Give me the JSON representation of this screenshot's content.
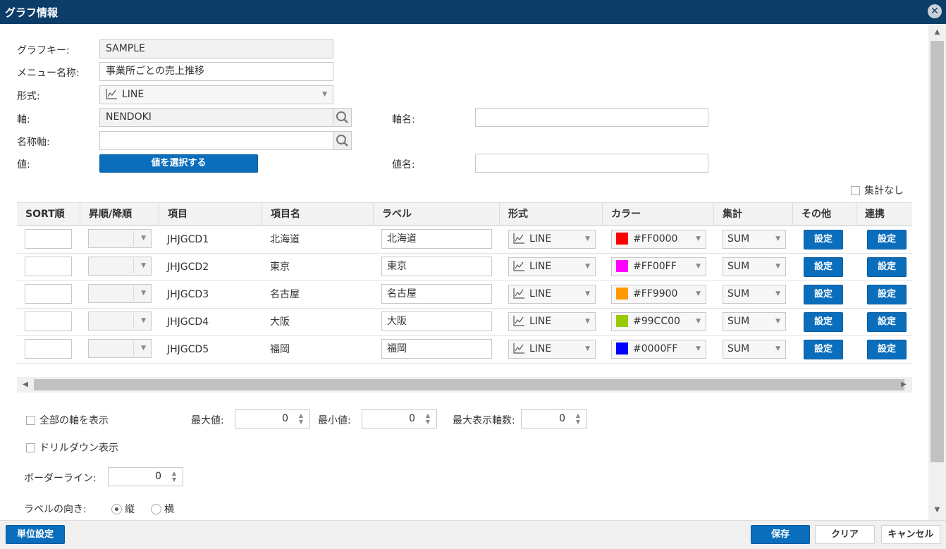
{
  "window": {
    "title": "グラフ情報",
    "close_glyph": "✕"
  },
  "form": {
    "graph_key_label": "グラフキー:",
    "graph_key_value": "SAMPLE",
    "menu_name_label": "メニュー名称:",
    "menu_name_value": "事業所ごとの売上推移",
    "format_label": "形式:",
    "format_value": "LINE",
    "axis_label": "軸:",
    "axis_value": "NENDOKI",
    "axis_name_label": "軸名:",
    "axis_name_value": "",
    "name_axis_label": "名称軸:",
    "name_axis_value": "",
    "value_label": "値:",
    "select_values_button": "値を選択する",
    "value_name_label": "値名:",
    "value_name_value": "",
    "no_aggregation_label": "集計なし"
  },
  "grid": {
    "headers": [
      "SORT順",
      "昇順/降順",
      "項目",
      "項目名",
      "ラベル",
      "形式",
      "カラー",
      "集計",
      "その他",
      "連携"
    ],
    "set_button_label": "設定",
    "rows": [
      {
        "sort": "",
        "order": "",
        "item": "JHJGCD1",
        "item_name": "北海道",
        "label": "北海道",
        "format": "LINE",
        "color": "#FF0000",
        "aggregate": "SUM"
      },
      {
        "sort": "",
        "order": "",
        "item": "JHJGCD2",
        "item_name": "東京",
        "label": "東京",
        "format": "LINE",
        "color": "#FF00FF",
        "aggregate": "SUM"
      },
      {
        "sort": "",
        "order": "",
        "item": "JHJGCD3",
        "item_name": "名古屋",
        "label": "名古屋",
        "format": "LINE",
        "color": "#FF9900",
        "aggregate": "SUM"
      },
      {
        "sort": "",
        "order": "",
        "item": "JHJGCD4",
        "item_name": "大阪",
        "label": "大阪",
        "format": "LINE",
        "color": "#99CC00",
        "aggregate": "SUM"
      },
      {
        "sort": "",
        "order": "",
        "item": "JHJGCD5",
        "item_name": "福岡",
        "label": "福岡",
        "format": "LINE",
        "color": "#0000FF",
        "aggregate": "SUM"
      }
    ]
  },
  "options": {
    "show_all_axes_label": "全部の軸を表示",
    "drilldown_label": "ドリルダウン表示",
    "max_label": "最大値:",
    "max_value": "0",
    "min_label": "最小値:",
    "min_value": "0",
    "max_axes_label": "最大表示軸数:",
    "max_axes_value": "0",
    "border_line_label": "ボーダーライン:",
    "border_line_value": "0",
    "label_orientation_label": "ラベルの向き:",
    "vertical_label": "縦",
    "horizontal_label": "横"
  },
  "footer": {
    "unit_settings": "単位設定",
    "save": "保存",
    "clear": "クリア",
    "cancel": "キャンセル"
  },
  "colors": {
    "titlebar": "#0b3d68",
    "primary_button": "#0a6ebd"
  }
}
